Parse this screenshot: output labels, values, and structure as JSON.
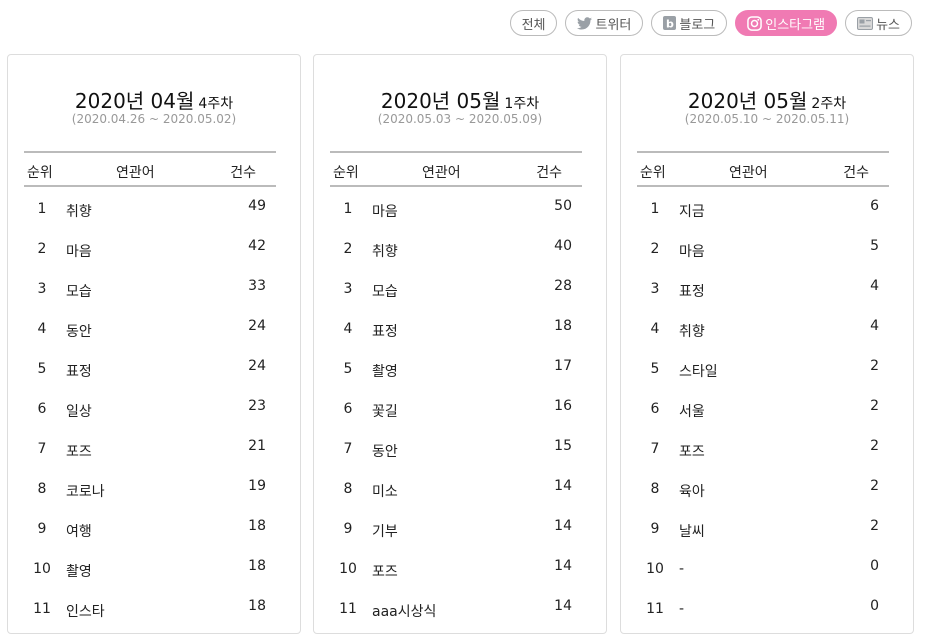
{
  "filters": [
    {
      "label": "전체",
      "icon": "",
      "active": false
    },
    {
      "label": "트위터",
      "icon": "twitter-icon",
      "active": false
    },
    {
      "label": "블로그",
      "icon": "blog-icon",
      "active": false
    },
    {
      "label": "인스타그램",
      "icon": "instagram-icon",
      "active": true
    },
    {
      "label": "뉴스",
      "icon": "news-icon",
      "active": false
    }
  ],
  "accent_color": "#f07ab3",
  "headers": {
    "rank": "순위",
    "word": "연관어",
    "count": "건수"
  },
  "cards": [
    {
      "title": "2020년 04월",
      "week": "4주차",
      "range": "(2020.04.26 ~ 2020.05.02)",
      "rows": [
        {
          "rank": "1",
          "word": "취향",
          "count": "49"
        },
        {
          "rank": "2",
          "word": "마음",
          "count": "42"
        },
        {
          "rank": "3",
          "word": "모습",
          "count": "33"
        },
        {
          "rank": "4",
          "word": "동안",
          "count": "24"
        },
        {
          "rank": "5",
          "word": "표정",
          "count": "24"
        },
        {
          "rank": "6",
          "word": "일상",
          "count": "23"
        },
        {
          "rank": "7",
          "word": "포즈",
          "count": "21"
        },
        {
          "rank": "8",
          "word": "코로나",
          "count": "19"
        },
        {
          "rank": "9",
          "word": "여행",
          "count": "18"
        },
        {
          "rank": "10",
          "word": "촬영",
          "count": "18"
        },
        {
          "rank": "11",
          "word": "인스타",
          "count": "18"
        }
      ]
    },
    {
      "title": "2020년 05월",
      "week": "1주차",
      "range": "(2020.05.03 ~ 2020.05.09)",
      "rows": [
        {
          "rank": "1",
          "word": "마음",
          "count": "50"
        },
        {
          "rank": "2",
          "word": "취향",
          "count": "40"
        },
        {
          "rank": "3",
          "word": "모습",
          "count": "28"
        },
        {
          "rank": "4",
          "word": "표정",
          "count": "18"
        },
        {
          "rank": "5",
          "word": "촬영",
          "count": "17"
        },
        {
          "rank": "6",
          "word": "꽃길",
          "count": "16"
        },
        {
          "rank": "7",
          "word": "동안",
          "count": "15"
        },
        {
          "rank": "8",
          "word": "미소",
          "count": "14"
        },
        {
          "rank": "9",
          "word": "기부",
          "count": "14"
        },
        {
          "rank": "10",
          "word": "포즈",
          "count": "14"
        },
        {
          "rank": "11",
          "word": "aaa시상식",
          "count": "14"
        }
      ]
    },
    {
      "title": "2020년 05월",
      "week": "2주차",
      "range": "(2020.05.10 ~ 2020.05.11)",
      "rows": [
        {
          "rank": "1",
          "word": "지금",
          "count": "6"
        },
        {
          "rank": "2",
          "word": "마음",
          "count": "5"
        },
        {
          "rank": "3",
          "word": "표정",
          "count": "4"
        },
        {
          "rank": "4",
          "word": "취향",
          "count": "4"
        },
        {
          "rank": "5",
          "word": "스타일",
          "count": "2"
        },
        {
          "rank": "6",
          "word": "서울",
          "count": "2"
        },
        {
          "rank": "7",
          "word": "포즈",
          "count": "2"
        },
        {
          "rank": "8",
          "word": "육아",
          "count": "2"
        },
        {
          "rank": "9",
          "word": "날씨",
          "count": "2"
        },
        {
          "rank": "10",
          "word": "-",
          "count": "0"
        },
        {
          "rank": "11",
          "word": "-",
          "count": "0"
        }
      ]
    }
  ]
}
